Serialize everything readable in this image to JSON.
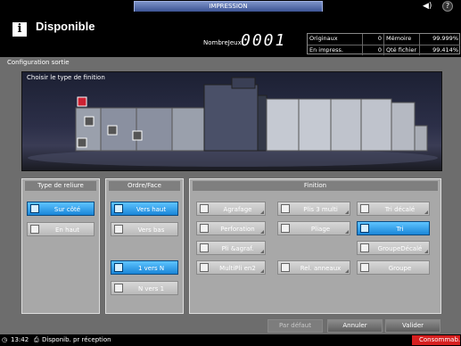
{
  "header": {
    "tab_label": "IMPRESSION",
    "state": "Disponible",
    "jobs_label": "NombreJeux",
    "jobs_value": "0001",
    "stats": {
      "originals_label": "Originaux",
      "originals_value": "0",
      "memory_label": "Mémoire",
      "memory_value": "99.999%",
      "printing_label": "En impress.",
      "printing_value": "0",
      "fileqty_label": "Qté fichier",
      "fileqty_value": "99.414%"
    }
  },
  "screen": {
    "title": "Configuration sortie",
    "preview_label": "Choisir le type de finition"
  },
  "binding": {
    "title": "Type de reliure",
    "buttons": [
      {
        "label": "Sur côté",
        "active": true
      },
      {
        "label": "En haut",
        "active": false
      }
    ]
  },
  "order": {
    "title": "Ordre/Face",
    "buttons": [
      {
        "label": "Vers haut",
        "active": true
      },
      {
        "label": "Vers bas",
        "active": false
      },
      {
        "label": "1 vers N",
        "active": true
      },
      {
        "label": "N vers 1",
        "active": false
      }
    ]
  },
  "finishing": {
    "title": "Finition",
    "buttons": [
      {
        "label": "Agrafage",
        "active": false
      },
      {
        "label": "Plis 3 multi",
        "active": false
      },
      {
        "label": "Tri décalé",
        "active": false
      },
      {
        "label": "Perforation",
        "active": false
      },
      {
        "label": "Pliage",
        "active": false
      },
      {
        "label": "Tri",
        "active": true
      },
      {
        "label": "Pli &agraf.",
        "active": false
      },
      {
        "label": "GroupeDécalé",
        "active": false
      },
      {
        "label": "MultiPli en2",
        "active": false
      },
      {
        "label": "Rel. anneaux",
        "active": false
      },
      {
        "label": "Groupe",
        "active": false
      }
    ]
  },
  "footer": {
    "default_label": "Par défaut",
    "cancel_label": "Annuler",
    "validate_label": "Valider"
  },
  "status": {
    "time": "13:42",
    "message": "Disponib. pr réception",
    "consumables": "Consommab."
  },
  "colors": {
    "accent": "#1a86d8",
    "panel": "#a8a8a8",
    "background": "#6d6d6d"
  }
}
